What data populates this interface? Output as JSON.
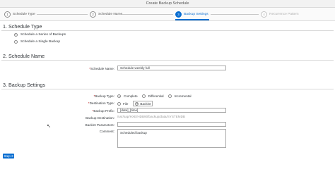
{
  "window": {
    "title": "Create Backup Schedule"
  },
  "wizard": {
    "steps": [
      {
        "num": "1",
        "label": "Schedule Type",
        "state": "done"
      },
      {
        "num": "2",
        "label": "Schedule Name",
        "state": "done"
      },
      {
        "num": "3",
        "label": "Backup Settings",
        "state": "active"
      },
      {
        "num": "4",
        "label": "Recurrence Pattern",
        "state": "disabled"
      }
    ]
  },
  "section1": {
    "title": "1. Schedule Type",
    "options": [
      {
        "label": "Schedule a Series of Backups",
        "selected": true
      },
      {
        "label": "Schedule a Single Backup",
        "selected": false
      }
    ]
  },
  "section2": {
    "title": "2. Schedule Name",
    "name_label": "Schedule Name:",
    "name_value": "Schedule weekly full"
  },
  "section3": {
    "title": "3. Backup Settings",
    "backup_type_label": "Backup Type:",
    "backup_type_options": [
      "Complete",
      "Differential",
      "Incremental"
    ],
    "backup_type_selected": "Complete",
    "destination_type_label": "Destination Type:",
    "destination_options": [
      "File",
      "Backint"
    ],
    "destination_selected": "Backint",
    "prefix_label": "Backup Prefix:",
    "prefix_value": "[date]_[time]",
    "destination_label": "Backup Destination:",
    "destination_value": "/usr/sap/HXE/HDB90/backup/data/SYSTEMDB",
    "backint_params_label": "Backint Parameters:",
    "backint_params_value": "",
    "comment_label": "Comment:",
    "comment_value": "Scheduled backup"
  },
  "footer": {
    "step_button": "Step 3"
  },
  "colors": {
    "accent": "#0a6ed1",
    "required": "#bb0000"
  }
}
